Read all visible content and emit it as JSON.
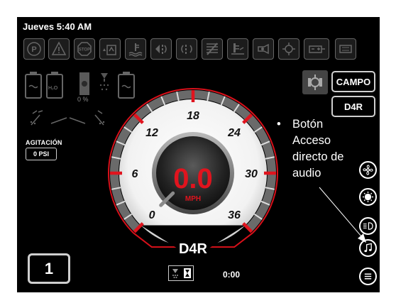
{
  "status": {
    "datetime": "Jueves 5:40 AM"
  },
  "warning_icons": [
    "parking-brake-icon",
    "warning-triangle-icon",
    "stop-icon",
    "fuel-water-icon",
    "water-temp-icon",
    "turn-signal-left-icon",
    "turn-signal-both-icon",
    "air-filter-icon",
    "hydraulic-level-icon",
    "transmission-icon",
    "engine-oil-icon",
    "battery-charge-icon",
    "dpf-icon"
  ],
  "tanks": {
    "fan_percent": "0 %",
    "water_label": "H₂O"
  },
  "agitation": {
    "label": "AGITACIÓN",
    "value": "0 PSI"
  },
  "gear_counter": {
    "value": "1"
  },
  "mode_buttons": {
    "campo": "CAMPO",
    "d4r": "D4R"
  },
  "speedometer": {
    "speed": "0.0",
    "unit": "MPH",
    "gear": "D4R",
    "max": 36,
    "ticks": [
      "0",
      "6",
      "12",
      "18",
      "24",
      "30",
      "36"
    ]
  },
  "timer": {
    "value": "0:00"
  },
  "side_buttons": [
    "fan-icon",
    "work-lights-icon",
    "headlights-icon",
    "music-note-icon",
    "menu-icon"
  ],
  "annotation": {
    "bullet": "•",
    "lines": [
      "Botón",
      "Acceso",
      "directo de",
      "audio"
    ]
  }
}
